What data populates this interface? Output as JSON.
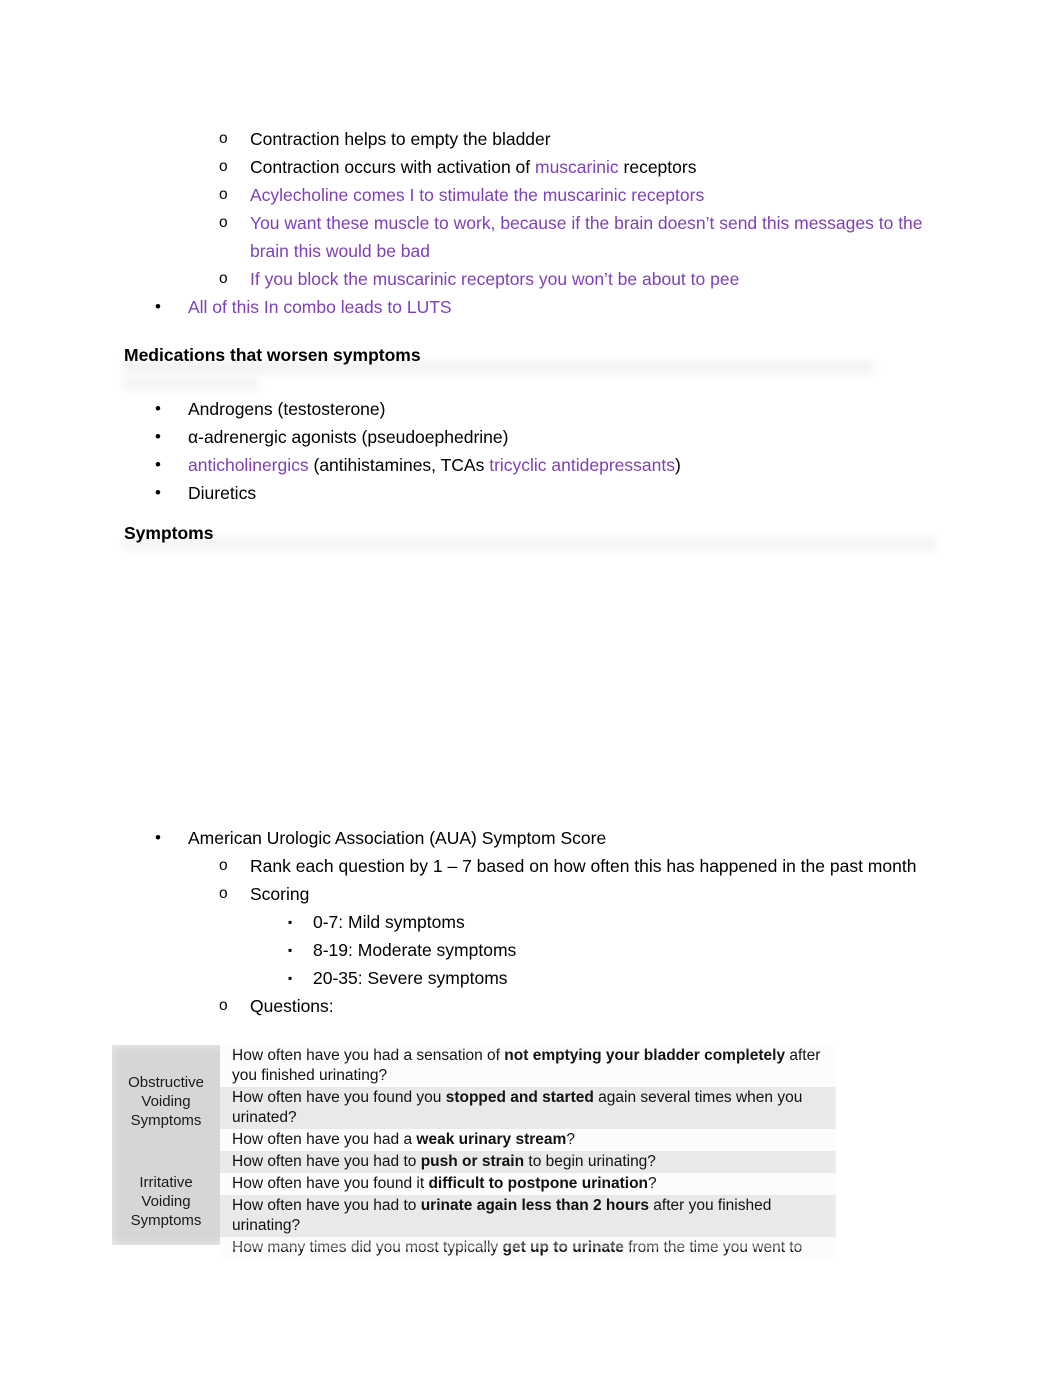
{
  "document": {
    "top_list": {
      "items": [
        {
          "marker": "o",
          "level": 2,
          "segments": [
            {
              "text": "Contraction helps to empty the bladder",
              "color": "black"
            }
          ]
        },
        {
          "marker": "o",
          "level": 2,
          "segments": [
            {
              "text": "Contraction occurs with activation of ",
              "color": "black"
            },
            {
              "text": "muscarinic",
              "color": "purple"
            },
            {
              "text": "  receptors",
              "color": "black"
            }
          ]
        },
        {
          "marker": "o",
          "level": 2,
          "segments": [
            {
              "text": "Acylecholine comes I to stimulate the muscarinic receptors",
              "color": "purple"
            }
          ]
        },
        {
          "marker": "o",
          "level": 2,
          "segments": [
            {
              "text": "You want these muscle to work, because if the brain doesn’t send this messages to the brain this would be bad",
              "color": "purple"
            }
          ]
        },
        {
          "marker": "o",
          "level": 2,
          "segments": [
            {
              "text": "If you block the muscarinic receptors you won’t be about to pee",
              "color": "purple"
            }
          ]
        },
        {
          "marker": "•",
          "level": 1,
          "segments": [
            {
              "text": "All of this In combo leads to LUTS",
              "color": "purple"
            }
          ]
        }
      ]
    },
    "heading_medications": "Medications that worsen symptoms",
    "medications_list": {
      "items": [
        {
          "marker": "•",
          "level": 1,
          "segments": [
            {
              "text": "Androgens (testosterone)",
              "color": "black"
            }
          ]
        },
        {
          "marker": "•",
          "level": 1,
          "segments": [
            {
              "text": "α-adrenergic agonists (pseudoephedrine)",
              "color": "black"
            }
          ]
        },
        {
          "marker": "•",
          "level": 1,
          "segments": [
            {
              "text": "anticholinergics",
              "color": "purple"
            },
            {
              "text": " (antihistamines, TCAs ",
              "color": "black"
            },
            {
              "text": "tricyclic antidepressants",
              "color": "purple"
            },
            {
              "text": ")",
              "color": "black"
            }
          ]
        },
        {
          "marker": "•",
          "level": 1,
          "segments": [
            {
              "text": "Diuretics",
              "color": "black"
            }
          ]
        }
      ]
    },
    "heading_symptoms": "Symptoms",
    "aua_list": {
      "items": [
        {
          "marker": "•",
          "level": 1,
          "segments": [
            {
              "text": "American Urologic Association (AUA) Symptom Score",
              "color": "black"
            }
          ]
        },
        {
          "marker": "o",
          "level": 2,
          "segments": [
            {
              "text": "Rank each question by 1 – 7 based on how often this has happened in the past month",
              "color": "black"
            }
          ]
        },
        {
          "marker": "o",
          "level": 2,
          "segments": [
            {
              "text": "Scoring",
              "color": "black"
            }
          ]
        },
        {
          "marker": "▪",
          "level": 3,
          "segments": [
            {
              "text": "0-7: Mild symptoms",
              "color": "black"
            }
          ]
        },
        {
          "marker": "▪",
          "level": 3,
          "segments": [
            {
              "text": "8-19: Moderate symptoms",
              "color": "black"
            }
          ]
        },
        {
          "marker": "▪",
          "level": 3,
          "segments": [
            {
              "text": "20-35: Severe symptoms",
              "color": "black"
            }
          ]
        },
        {
          "marker": "o",
          "level": 2,
          "segments": [
            {
              "text": "Questions:",
              "color": "black"
            }
          ]
        }
      ]
    },
    "aua_table": {
      "categories": [
        {
          "label": "Obstructive Voiding Symptoms",
          "lines": [
            "Obstructive",
            "Voiding",
            "Symptoms"
          ]
        },
        {
          "label": "Irritative Voiding Symptoms",
          "lines": [
            "Irritative",
            "Voiding",
            "Symptoms"
          ]
        }
      ],
      "questions": [
        {
          "group": "obstructive",
          "shade": "a",
          "parts": [
            {
              "text": "How often have you had a sensation of ",
              "bold": false
            },
            {
              "text": "not emptying your bladder completely",
              "bold": true
            },
            {
              "text": " after you finished urinating?",
              "bold": false
            }
          ]
        },
        {
          "group": "obstructive",
          "shade": "b",
          "parts": [
            {
              "text": "How often have you found you ",
              "bold": false
            },
            {
              "text": "stopped and started",
              "bold": true
            },
            {
              "text": " again several times when you urinated?",
              "bold": false
            }
          ]
        },
        {
          "group": "obstructive",
          "shade": "a",
          "parts": [
            {
              "text": "How often have you had a ",
              "bold": false
            },
            {
              "text": "weak urinary stream",
              "bold": true
            },
            {
              "text": "?",
              "bold": false
            }
          ]
        },
        {
          "group": "obstructive",
          "shade": "b",
          "parts": [
            {
              "text": "How often have you had to ",
              "bold": false
            },
            {
              "text": "push or strain",
              "bold": true
            },
            {
              "text": " to begin urinating?",
              "bold": false
            }
          ]
        },
        {
          "group": "irritative",
          "shade": "a",
          "parts": [
            {
              "text": "How often have you found it ",
              "bold": false
            },
            {
              "text": "difficult to postpone urination",
              "bold": true
            },
            {
              "text": "?",
              "bold": false
            }
          ]
        },
        {
          "group": "irritative",
          "shade": "b",
          "parts": [
            {
              "text": "How often have you had to ",
              "bold": false
            },
            {
              "text": "urinate again less than 2 hours",
              "bold": true
            },
            {
              "text": " after you finished urinating?",
              "bold": false
            }
          ]
        },
        {
          "group": "irritative",
          "shade": "a",
          "parts": [
            {
              "text": "How many times did you most typically ",
              "bold": false
            },
            {
              "text": "get up to urinate",
              "bold": true
            },
            {
              "text": " from the time you went to",
              "bold": false
            }
          ]
        }
      ]
    },
    "colors": {
      "purple_text": "#7f3fb5",
      "body_text": "#000000",
      "table_category_bg": "#d6d6d6",
      "table_row_light": "#fcfcfc",
      "table_row_shaded": "#e9e9e9"
    }
  }
}
